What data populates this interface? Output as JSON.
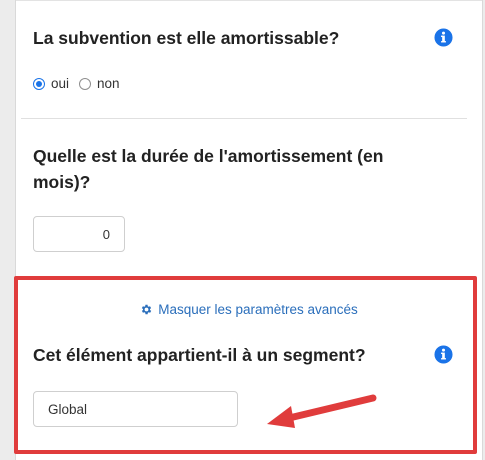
{
  "question_amortissable": {
    "label": "La subvention est elle amortissable?",
    "options": [
      "oui",
      "non"
    ],
    "selected": "oui"
  },
  "question_duree": {
    "label": "Quelle est la durée de l'amortissement (en mois)?",
    "value": "0"
  },
  "advanced": {
    "toggle_label": "Masquer les paramètres avancés",
    "icon": "gear-icon"
  },
  "question_segment": {
    "label": "Cet élément appartient-il à un segment?",
    "value": "Global"
  },
  "colors": {
    "accent": "#1a73e8",
    "link": "#2a6ebb",
    "highlight": "#e03c3c"
  }
}
